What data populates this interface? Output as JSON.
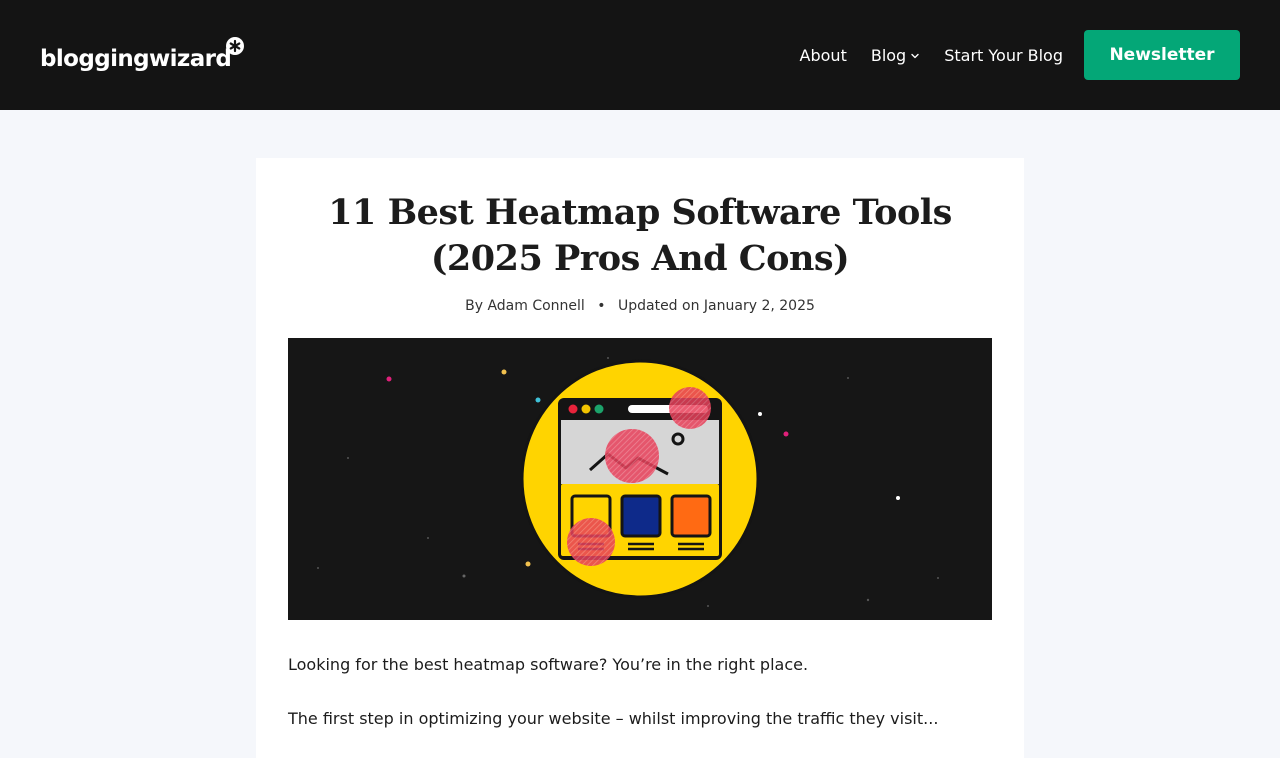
{
  "header": {
    "logo_text": "bloggingwizard",
    "logo_icon": "asterisk-star-icon",
    "nav": [
      {
        "label": "About"
      },
      {
        "label": "Blog",
        "has_dropdown": true
      },
      {
        "label": "Start Your Blog"
      }
    ],
    "cta_label": "Newsletter",
    "background": "#141414",
    "cta_color": "#04a777"
  },
  "article": {
    "title": "11 Best Heatmap Software Tools (2025 Pros And Cons)",
    "author_prefix": "By",
    "author": "Adam Connell",
    "updated_prefix": "Updated on",
    "updated_date": "January 2, 2025",
    "hero_icon": "heatmap-browser-illustration",
    "paragraphs": [
      "Looking for the best heatmap software? You’re in the right place.",
      "The first step in optimizing your website – whilst improving the traffic they visit..."
    ]
  },
  "colors": {
    "page_bg": "#f5f7fb",
    "hero_bg": "#161616",
    "hero_circle": "#ffd400",
    "heat_spot": "#e8405a"
  }
}
